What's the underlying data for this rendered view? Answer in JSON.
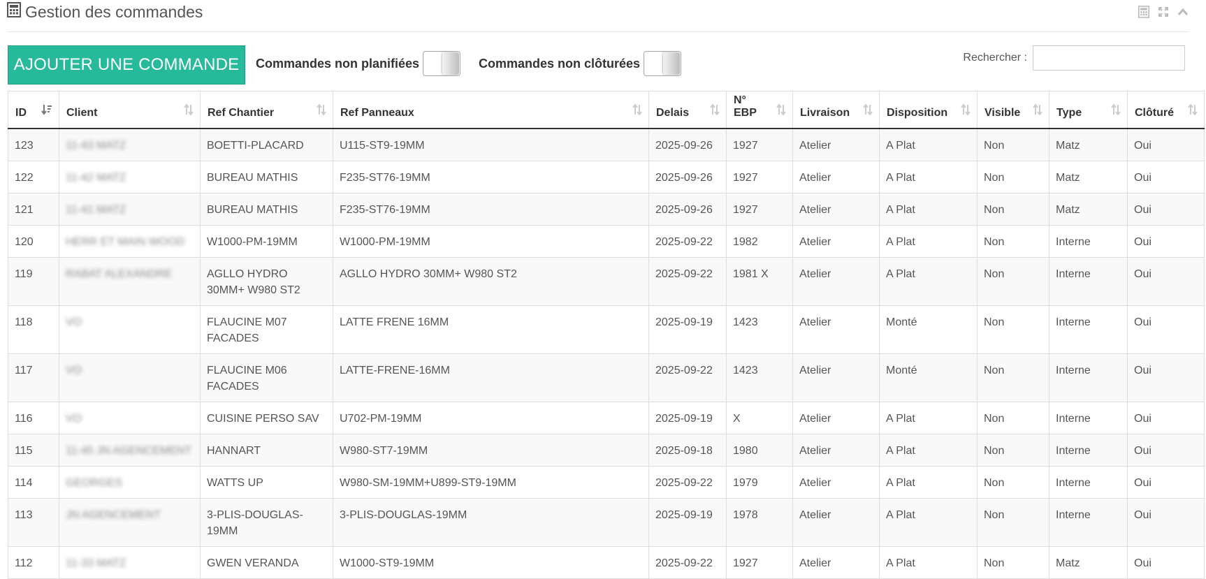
{
  "panel": {
    "title": "Gestion des commandes"
  },
  "toolbar": {
    "add_label": "AJOUTER UNE COMMANDE",
    "filter_unplanned": "Commandes non planifiées",
    "filter_unclosed": "Commandes non clôturées",
    "search_label": "Rechercher :",
    "search_value": ""
  },
  "table": {
    "headers": {
      "id": "ID",
      "client": "Client",
      "ref_chantier": "Ref Chantier",
      "ref_panneaux": "Ref Panneaux",
      "delais": "Delais",
      "ebp_line1": "N°",
      "ebp_line2": "EBP",
      "livraison": "Livraison",
      "disposition": "Disposition",
      "visible": "Visible",
      "type": "Type",
      "cloture": "Clôturé"
    },
    "rows": [
      {
        "id": "123",
        "client": "11-43 MATZ",
        "ref_chantier": "BOETTI-PLACARD",
        "ref_panneaux": "U115-ST9-19MM",
        "delais": "2025-09-26",
        "ebp": "1927",
        "livraison": "Atelier",
        "disposition": "A Plat",
        "visible": "Non",
        "type": "Matz",
        "cloture": "Oui"
      },
      {
        "id": "122",
        "client": "11-42 MATZ",
        "ref_chantier": "BUREAU MATHIS",
        "ref_panneaux": "F235-ST76-19MM",
        "delais": "2025-09-26",
        "ebp": "1927",
        "livraison": "Atelier",
        "disposition": "A Plat",
        "visible": "Non",
        "type": "Matz",
        "cloture": "Oui"
      },
      {
        "id": "121",
        "client": "11-41 MATZ",
        "ref_chantier": "BUREAU MATHIS",
        "ref_panneaux": "F235-ST76-19MM",
        "delais": "2025-09-26",
        "ebp": "1927",
        "livraison": "Atelier",
        "disposition": "A Plat",
        "visible": "Non",
        "type": "Matz",
        "cloture": "Oui"
      },
      {
        "id": "120",
        "client": "HERR ET MAIN WOOD",
        "ref_chantier": "W1000-PM-19MM",
        "ref_panneaux": "W1000-PM-19MM",
        "delais": "2025-09-22",
        "ebp": "1982",
        "livraison": "Atelier",
        "disposition": "A Plat",
        "visible": "Non",
        "type": "Interne",
        "cloture": "Oui"
      },
      {
        "id": "119",
        "client": "RABAT ALEXANDRE",
        "ref_chantier": "AGLLO HYDRO 30MM+ W980 ST2",
        "ref_panneaux": "AGLLO HYDRO 30MM+ W980 ST2",
        "delais": "2025-09-22",
        "ebp": "1981 X",
        "livraison": "Atelier",
        "disposition": "A Plat",
        "visible": "Non",
        "type": "Interne",
        "cloture": "Oui"
      },
      {
        "id": "118",
        "client": "VO",
        "ref_chantier": "FLAUCINE M07 FACADES",
        "ref_panneaux": "LATTE FRENE 16MM",
        "delais": "2025-09-19",
        "ebp": "1423",
        "livraison": "Atelier",
        "disposition": "Monté",
        "visible": "Non",
        "type": "Interne",
        "cloture": "Oui"
      },
      {
        "id": "117",
        "client": "VO",
        "ref_chantier": "FLAUCINE M06 FACADES",
        "ref_panneaux": "LATTE-FRENE-16MM",
        "delais": "2025-09-22",
        "ebp": "1423",
        "livraison": "Atelier",
        "disposition": "Monté",
        "visible": "Non",
        "type": "Interne",
        "cloture": "Oui"
      },
      {
        "id": "116",
        "client": "VO",
        "ref_chantier": "CUISINE PERSO SAV",
        "ref_panneaux": "U702-PM-19MM",
        "delais": "2025-09-19",
        "ebp": "X",
        "livraison": "Atelier",
        "disposition": "A Plat",
        "visible": "Non",
        "type": "Interne",
        "cloture": "Oui"
      },
      {
        "id": "115",
        "client": "11-45 JN AGENCEMENT",
        "ref_chantier": "HANNART",
        "ref_panneaux": "W980-ST7-19MM",
        "delais": "2025-09-18",
        "ebp": "1980",
        "livraison": "Atelier",
        "disposition": "A Plat",
        "visible": "Non",
        "type": "Interne",
        "cloture": "Oui"
      },
      {
        "id": "114",
        "client": "GEORGES",
        "ref_chantier": "WATTS UP",
        "ref_panneaux": "W980-SM-19MM+U899-ST9-19MM",
        "delais": "2025-09-22",
        "ebp": "1979",
        "livraison": "Atelier",
        "disposition": "A Plat",
        "visible": "Non",
        "type": "Interne",
        "cloture": "Oui"
      },
      {
        "id": "113",
        "client": "JN AGENCEMENT",
        "ref_chantier": "3-PLIS-DOUGLAS-19MM",
        "ref_panneaux": "3-PLIS-DOUGLAS-19MM",
        "delais": "2025-09-19",
        "ebp": "1978",
        "livraison": "Atelier",
        "disposition": "A Plat",
        "visible": "Non",
        "type": "Interne",
        "cloture": "Oui"
      },
      {
        "id": "112",
        "client": "11-33 MATZ",
        "ref_chantier": "GWEN VERANDA",
        "ref_panneaux": "W1000-ST9-19MM",
        "delais": "2025-09-22",
        "ebp": "1927",
        "livraison": "Atelier",
        "disposition": "A Plat",
        "visible": "Non",
        "type": "Matz",
        "cloture": "Oui"
      }
    ]
  },
  "colors": {
    "accent": "#26b99a",
    "header_border": "#333333",
    "row_stripe": "#f9f9f9"
  },
  "icons": {
    "title": "calculator-icon",
    "tools": [
      "calculator-icon",
      "expand-icon",
      "chevron-up-icon"
    ],
    "sort_active": "sort-desc-icon",
    "sort_inactive": "sort-both-icon"
  }
}
